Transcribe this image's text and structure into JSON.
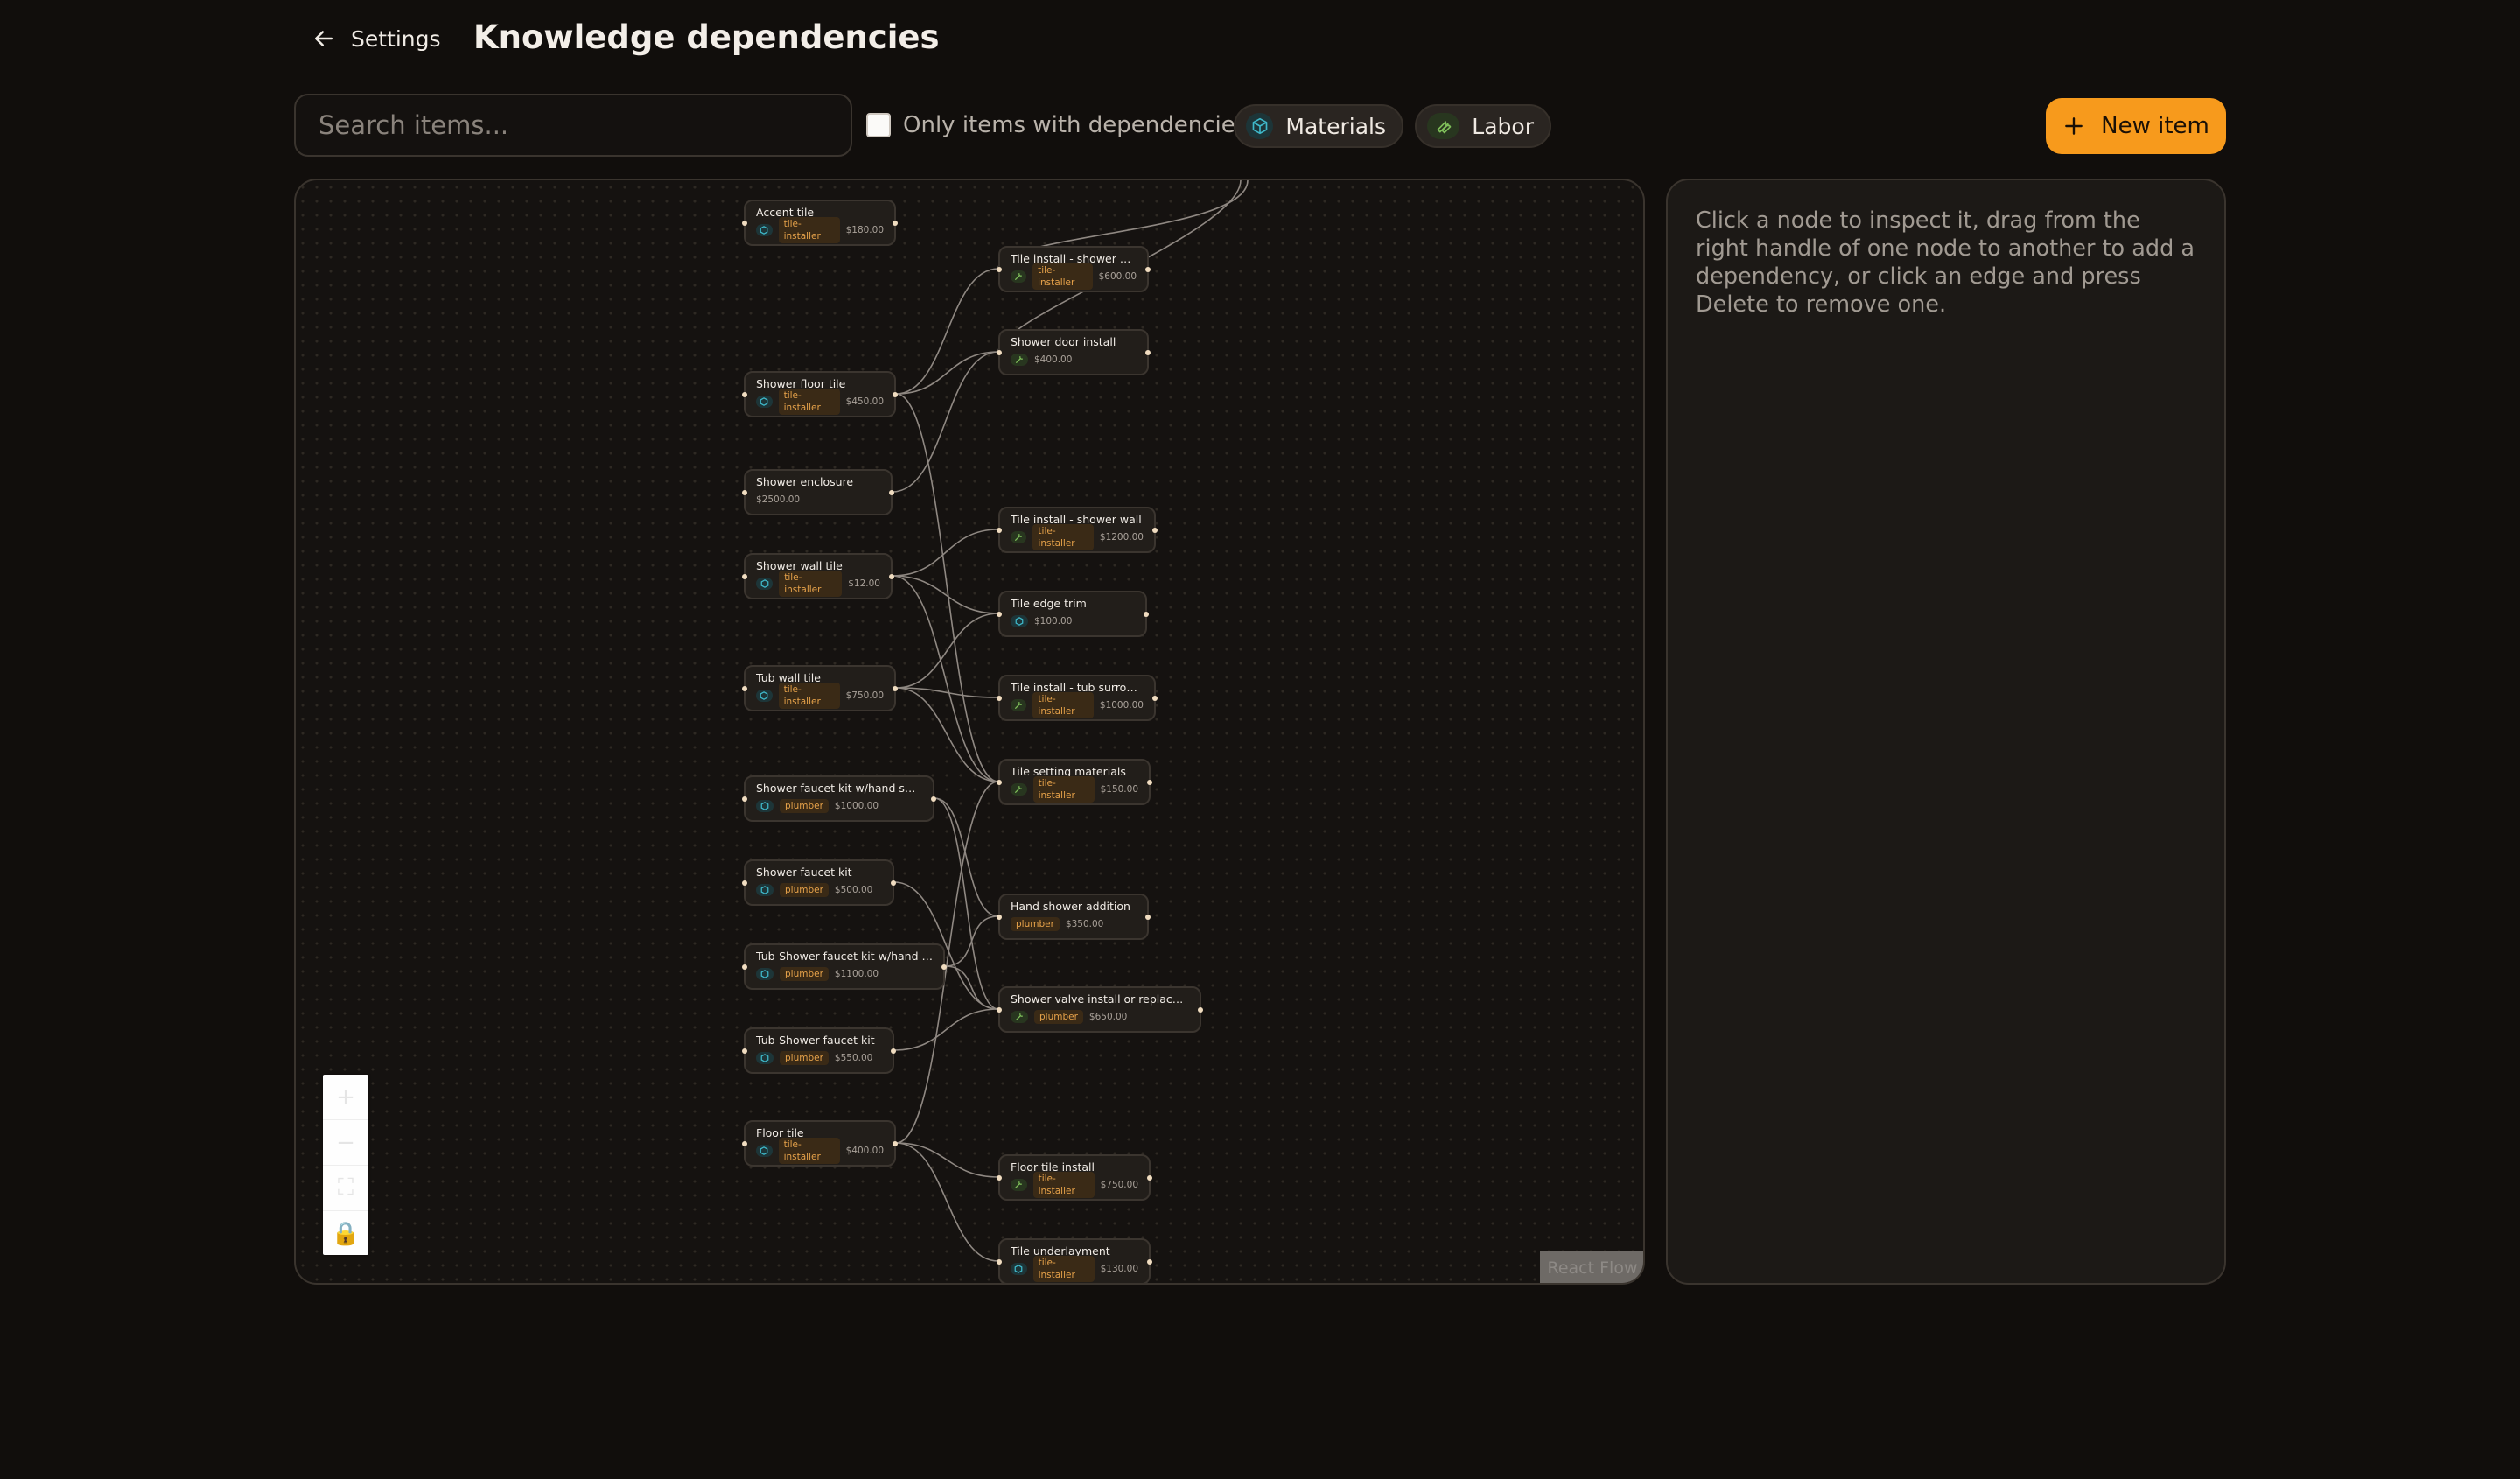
{
  "header": {
    "back_label": "Settings",
    "title": "Knowledge dependencies"
  },
  "toolbar": {
    "search_placeholder": "Search items...",
    "search_value": "",
    "only_dependencies_label": "Only items with dependencies",
    "only_dependencies_checked": false,
    "chips": [
      {
        "label": "Materials",
        "icon": "cube-icon",
        "color": "#3fb8c9"
      },
      {
        "label": "Labor",
        "icon": "wrench-icon",
        "color": "#7fbf5a"
      }
    ],
    "new_item_label": "New item"
  },
  "graph": {
    "nodes": [
      {
        "id": "accent-tile",
        "label": "Accent tile",
        "kind": "material",
        "tag": "tile-installer",
        "price": "$180.00"
      },
      {
        "id": "tile-install-shower-floor",
        "label": "Tile install - shower floor",
        "kind": "labor",
        "tag": "tile-installer",
        "price": "$600.00"
      },
      {
        "id": "shower-door-install",
        "label": "Shower door install",
        "kind": "labor",
        "tag": "",
        "price": "$400.00"
      },
      {
        "id": "shower-floor-tile",
        "label": "Shower floor tile",
        "kind": "material",
        "tag": "tile-installer",
        "price": "$450.00"
      },
      {
        "id": "shower-enclosure",
        "label": "Shower enclosure",
        "kind": "none",
        "tag": "",
        "price": "$2500.00"
      },
      {
        "id": "tile-install-shower-wall",
        "label": "Tile install - shower wall",
        "kind": "labor",
        "tag": "tile-installer",
        "price": "$1200.00"
      },
      {
        "id": "shower-wall-tile",
        "label": "Shower wall tile",
        "kind": "material",
        "tag": "tile-installer",
        "price": "$12.00"
      },
      {
        "id": "tile-edge-trim",
        "label": "Tile edge trim",
        "kind": "material",
        "tag": "",
        "price": "$100.00"
      },
      {
        "id": "tub-wall-tile",
        "label": "Tub wall tile",
        "kind": "material",
        "tag": "tile-installer",
        "price": "$750.00"
      },
      {
        "id": "tile-install-tub-surround",
        "label": "Tile install - tub surround",
        "kind": "labor",
        "tag": "tile-installer",
        "price": "$1000.00"
      },
      {
        "id": "shower-faucet-kit-hand",
        "label": "Shower faucet kit w/hand shower",
        "kind": "material",
        "tag": "plumber",
        "price": "$1000.00"
      },
      {
        "id": "tile-setting-materials",
        "label": "Tile setting materials",
        "kind": "labor",
        "tag": "tile-installer",
        "price": "$150.00"
      },
      {
        "id": "shower-faucet-kit",
        "label": "Shower faucet kit",
        "kind": "material",
        "tag": "plumber",
        "price": "$500.00"
      },
      {
        "id": "hand-shower-addition",
        "label": "Hand shower addition",
        "kind": "none",
        "tag": "plumber",
        "price": "$350.00"
      },
      {
        "id": "tub-shower-faucet-kit-hand",
        "label": "Tub-Shower faucet kit w/hand sh...",
        "kind": "material",
        "tag": "plumber",
        "price": "$1100.00"
      },
      {
        "id": "shower-valve-install",
        "label": "Shower valve install or replaceme...",
        "kind": "labor",
        "tag": "plumber",
        "price": "$650.00"
      },
      {
        "id": "tub-shower-faucet-kit",
        "label": "Tub-Shower faucet kit",
        "kind": "material",
        "tag": "plumber",
        "price": "$550.00"
      },
      {
        "id": "floor-tile",
        "label": "Floor tile",
        "kind": "material",
        "tag": "tile-installer",
        "price": "$400.00"
      },
      {
        "id": "floor-tile-install",
        "label": "Floor tile install",
        "kind": "labor",
        "tag": "tile-installer",
        "price": "$750.00"
      },
      {
        "id": "tile-underlayment",
        "label": "Tile underlayment",
        "kind": "material",
        "tag": "tile-installer",
        "price": "$130.00"
      }
    ],
    "edges": [
      [
        "shower-floor-tile",
        "tile-install-shower-floor"
      ],
      [
        "shower-floor-tile",
        "shower-door-install"
      ],
      [
        "shower-floor-tile",
        "tile-setting-materials"
      ],
      [
        "shower-enclosure",
        "shower-door-install"
      ],
      [
        "shower-wall-tile",
        "tile-install-shower-wall"
      ],
      [
        "shower-wall-tile",
        "tile-edge-trim"
      ],
      [
        "shower-wall-tile",
        "tile-setting-materials"
      ],
      [
        "tub-wall-tile",
        "tile-edge-trim"
      ],
      [
        "tub-wall-tile",
        "tile-install-tub-surround"
      ],
      [
        "tub-wall-tile",
        "tile-setting-materials"
      ],
      [
        "shower-faucet-kit-hand",
        "hand-shower-addition"
      ],
      [
        "shower-faucet-kit-hand",
        "shower-valve-install"
      ],
      [
        "shower-faucet-kit",
        "shower-valve-install"
      ],
      [
        "tub-shower-faucet-kit-hand",
        "hand-shower-addition"
      ],
      [
        "tub-shower-faucet-kit-hand",
        "shower-valve-install"
      ],
      [
        "tub-shower-faucet-kit",
        "shower-valve-install"
      ],
      [
        "floor-tile",
        "floor-tile-install"
      ],
      [
        "floor-tile",
        "tile-underlayment"
      ],
      [
        "floor-tile",
        "tile-setting-materials"
      ]
    ],
    "attribution": "React Flow"
  },
  "inspector": {
    "hint": "Click a node to inspect it, drag from the right handle of one node to another to add a dependency, or click an edge and press Delete to remove one."
  },
  "colors": {
    "accent": "#f79a1c",
    "background": "#110e0c",
    "tag_text": "#e6a24a",
    "material_icon": "#3fb8c9",
    "labor_icon": "#7fbf5a"
  }
}
